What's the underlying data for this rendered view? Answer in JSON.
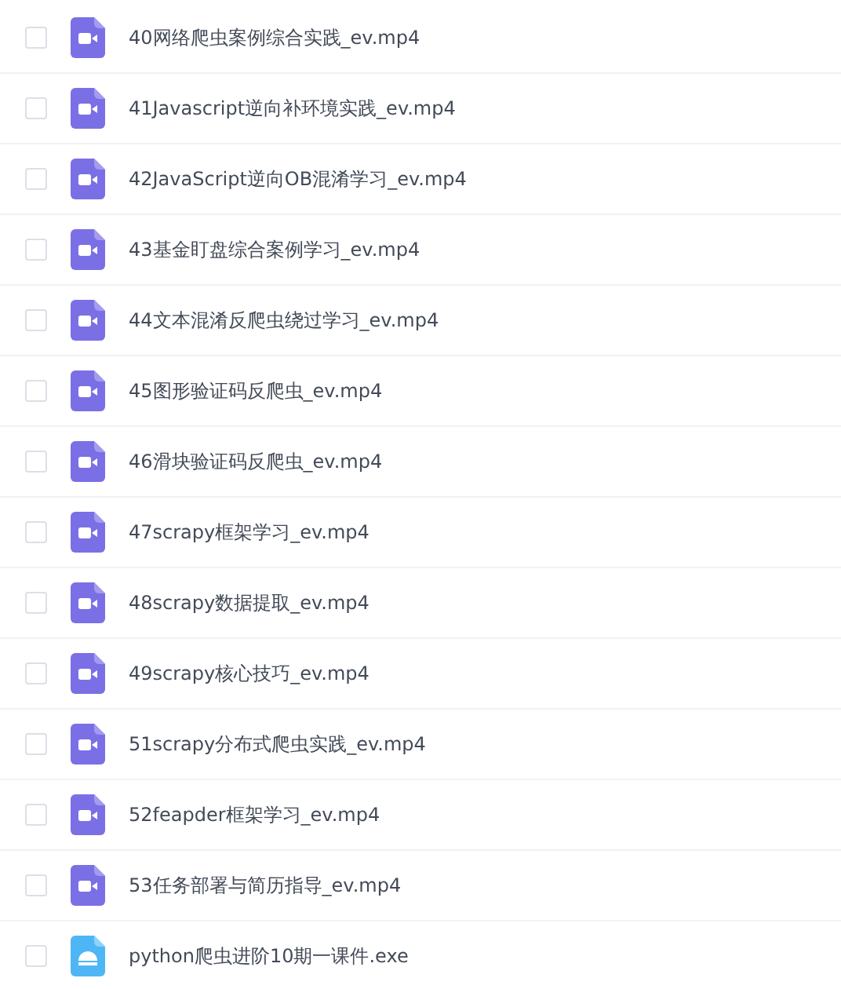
{
  "files": [
    {
      "name": "40网络爬虫案例综合实践_ev.mp4",
      "kind": "video",
      "checked": false
    },
    {
      "name": "41Javascript逆向补环境实践_ev.mp4",
      "kind": "video",
      "checked": false
    },
    {
      "name": "42JavaScript逆向OB混淆学习_ev.mp4",
      "kind": "video",
      "checked": false
    },
    {
      "name": "43基金盯盘综合案例学习_ev.mp4",
      "kind": "video",
      "checked": false
    },
    {
      "name": "44文本混淆反爬虫绕过学习_ev.mp4",
      "kind": "video",
      "checked": false
    },
    {
      "name": "45图形验证码反爬虫_ev.mp4",
      "kind": "video",
      "checked": false
    },
    {
      "name": "46滑块验证码反爬虫_ev.mp4",
      "kind": "video",
      "checked": false
    },
    {
      "name": "47scrapy框架学习_ev.mp4",
      "kind": "video",
      "checked": false
    },
    {
      "name": "48scrapy数据提取_ev.mp4",
      "kind": "video",
      "checked": false
    },
    {
      "name": "49scrapy核心技巧_ev.mp4",
      "kind": "video",
      "checked": false
    },
    {
      "name": "51scrapy分布式爬虫实践_ev.mp4",
      "kind": "video",
      "checked": false
    },
    {
      "name": "52feapder框架学习_ev.mp4",
      "kind": "video",
      "checked": false
    },
    {
      "name": "53任务部署与简历指导_ev.mp4",
      "kind": "video",
      "checked": false
    },
    {
      "name": "python爬虫进阶10期一课件.exe",
      "kind": "app",
      "checked": false
    }
  ]
}
